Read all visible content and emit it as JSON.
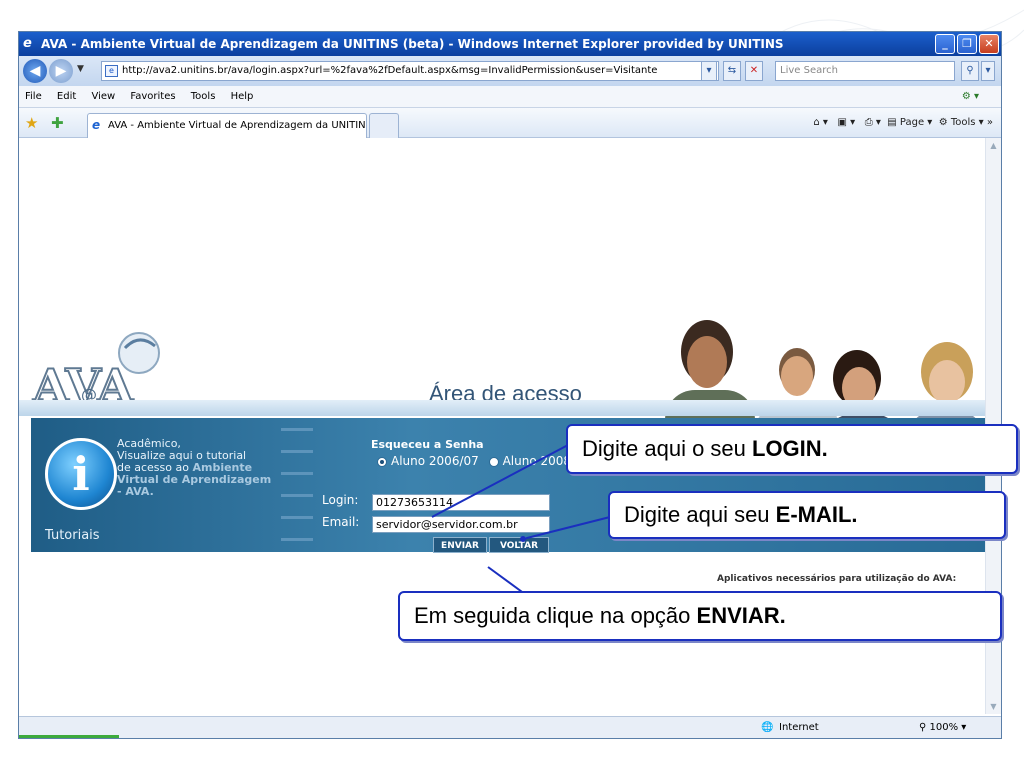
{
  "window": {
    "title": "AVA - Ambiente Virtual de Aprendizagem da UNITINS (beta) - Windows Internet Explorer provided by UNITINS",
    "url": "http://ava2.unitins.br/ava/login.aspx?url=%2fava%2fDefault.aspx&msg=InvalidPermission&user=Visitante",
    "search_placeholder": "Live Search",
    "menu": [
      "File",
      "Edit",
      "View",
      "Favorites",
      "Tools",
      "Help"
    ],
    "tab_label": "AVA - Ambiente Virtual de Aprendizagem da UNITINS ...",
    "cmd_page": "Page",
    "cmd_tools": "Tools",
    "status_zone": "Internet",
    "zoom": "100%"
  },
  "page": {
    "logo_text": "AVA",
    "area_title": "Área de acesso",
    "tutorial": {
      "label": "Tutoriais",
      "line1": "Acadêmico,",
      "line2": "Visualize aqui o tutorial",
      "line3": "de acesso ao",
      "highlight1": "Ambiente",
      "highlight2": "Virtual de Aprendizagem",
      "highlight3": "- AVA."
    },
    "forgot": "Esqueceu a Senha",
    "radio1": "Aluno 2006/07",
    "radio2": "Aluno 2008",
    "login_label": "Login:",
    "login_value": "01273653114",
    "email_label": "Email:",
    "email_value": "servidor@servidor.com.br",
    "btn_send": "ENVIAR",
    "btn_back": "VOLTAR",
    "apps_note": "Aplicativos necessários para utilização do AVA:"
  },
  "callouts": {
    "login_pre": "Digite aqui o seu ",
    "login_bold": "LOGIN.",
    "email_pre": "Digite aqui seu ",
    "email_bold": "E-MAIL.",
    "send_pre": "Em seguida clique na opção ",
    "send_bold": "ENVIAR."
  },
  "colors": {
    "titlebar": "#0c3f9e",
    "panel": "#2f77a5",
    "callout_border": "#1a2fbf"
  }
}
